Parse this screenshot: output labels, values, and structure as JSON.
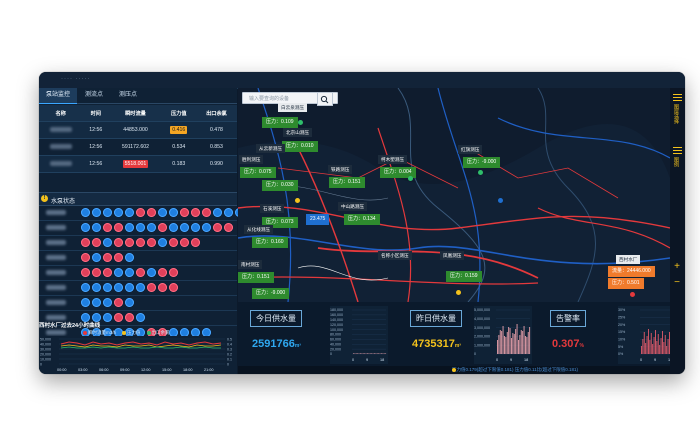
{
  "window": {
    "title": "···· ·····"
  },
  "tabs": [
    {
      "label": "泵站监控",
      "active": true
    },
    {
      "label": "测流点",
      "active": false
    },
    {
      "label": "测压点",
      "active": false
    }
  ],
  "monitor_table": {
    "headers": [
      "名称",
      "时间",
      "瞬时流量",
      "压力值",
      "出口余氯"
    ],
    "rows": [
      {
        "time": "12:56",
        "flow": "44853.000",
        "pressure": "0.416",
        "pressure_flag": "orange",
        "chlorine": "0.478"
      },
      {
        "time": "12:56",
        "flow": "591172.602",
        "pressure": "0.534",
        "pressure_flag": "",
        "chlorine": "0.853"
      },
      {
        "time": "12:56",
        "flow": "5518.001",
        "pressure": "0.183",
        "pressure_flag": "",
        "chlorine": "0.990",
        "flow_flag": "red"
      }
    ]
  },
  "pump_status": {
    "title": "水泵状态",
    "rows": [
      [
        "b",
        "b",
        "b",
        "b",
        "b",
        "r",
        "r",
        "b",
        "b",
        "r",
        "r",
        "r",
        "b",
        "b",
        "b",
        "b",
        "b",
        "r",
        "r",
        "r",
        "r"
      ],
      [
        "b",
        "b",
        "r",
        "r",
        "b",
        "b",
        "b",
        "r",
        "b",
        "b",
        "b",
        "b",
        "r",
        "r"
      ],
      [
        "r",
        "r",
        "b",
        "r",
        "r",
        "r",
        "r",
        "b",
        "r",
        "r",
        "r"
      ],
      [
        "r",
        "b",
        "r",
        "r",
        "b"
      ],
      [
        "r",
        "r",
        "r",
        "b",
        "b",
        "r",
        "b",
        "r",
        "r"
      ],
      [
        "b",
        "b",
        "b",
        "b",
        "b",
        "b",
        "r",
        "r",
        "r"
      ],
      [
        "b",
        "b",
        "b",
        "r",
        "b"
      ],
      [
        "b",
        "b",
        "b",
        "r",
        "r",
        "b"
      ],
      [
        "b",
        "b",
        "b",
        "b",
        "b",
        "b",
        "r",
        "r",
        "b",
        "b",
        "b",
        "b"
      ]
    ]
  },
  "curve": {
    "title": "西村水厂过去24小时曲线",
    "legend": [
      {
        "label": "瞬时流量m3/h",
        "color": "#e4393c"
      },
      {
        "label": "压力值",
        "color": "#f4c21c"
      },
      {
        "label": "出口余氯",
        "color": "#2fbf6b"
      }
    ],
    "yticks_left": [
      "50,000",
      "40,000",
      "30,000",
      "20,000",
      "10,000",
      "0"
    ],
    "yticks_right": [
      "0.5",
      "0.4",
      "0.3",
      "0.2",
      "0.1",
      "0"
    ],
    "xticks": [
      "00:00",
      "03:00",
      "06:00",
      "09:00",
      "12:00",
      "15:00",
      "18:00",
      "21:00"
    ]
  },
  "search": {
    "placeholder": "输入要查询的设备"
  },
  "right_bar": {
    "item1": "图层选择",
    "item2": "图例"
  },
  "map_labels": [
    {
      "text": "压力：0.109"
    },
    {
      "text": "压力：0.010"
    },
    {
      "text": "压力：0.075"
    },
    {
      "text": "压力：0.030"
    },
    {
      "text": "压力：0.151"
    },
    {
      "text": "压力：0.004"
    },
    {
      "text": "压力：-9.000"
    },
    {
      "text": "压力：0.073"
    },
    {
      "text": "23.475"
    },
    {
      "text": "压力：0.134"
    },
    {
      "text": "压力：0.160"
    },
    {
      "text": "压力：0.151"
    },
    {
      "text": "压力：-9.000"
    },
    {
      "text": "压力：0.159"
    },
    {
      "text": "流量：24446.000"
    },
    {
      "text": "压力：0.501"
    }
  ],
  "map_titles": [
    "白云泉测压",
    "北京山测压",
    "从云新测压",
    "胜利测压",
    "铁路测压",
    "红旗测压",
    "柯木塱测压",
    "石溪测压",
    "从化线测压",
    "中山路测压",
    "南村测压",
    "凤凰测压",
    "名称小区测压",
    "西村水厂"
  ],
  "stats": [
    {
      "label": "今日供水量",
      "value": "2591766",
      "unit": "m³",
      "color": "#2fa8f0"
    },
    {
      "label": "昨日供水量",
      "value": "4735317",
      "unit": "m³",
      "color": "#f4c21c"
    },
    {
      "label": "告警率",
      "value": "0.307",
      "unit": "%",
      "color": "#e4393c"
    }
  ],
  "mini_chart1": {
    "yticks": [
      "180,000",
      "160,000",
      "140,000",
      "120,000",
      "100,000",
      "80,000",
      "60,000",
      "40,000",
      "20,000",
      "0"
    ],
    "xticks": [
      "0",
      "9",
      "18"
    ]
  },
  "mini_chart2": {
    "yticks": [
      "5,000,000",
      "4,000,000",
      "3,000,000",
      "2,000,000",
      "1,000,000",
      "0"
    ],
    "xticks": [
      "0",
      "9",
      "18"
    ]
  },
  "mini_chart3": {
    "yticks": [
      "30%",
      "25%",
      "20%",
      "15%",
      "10%",
      "5%",
      "0%"
    ],
    "xticks": [
      "0",
      "9",
      "18"
    ]
  },
  "ticker": {
    "text": "压力值0.179(超过下限值0.181)    压力值0.11比(超过下限值0.181)"
  }
}
